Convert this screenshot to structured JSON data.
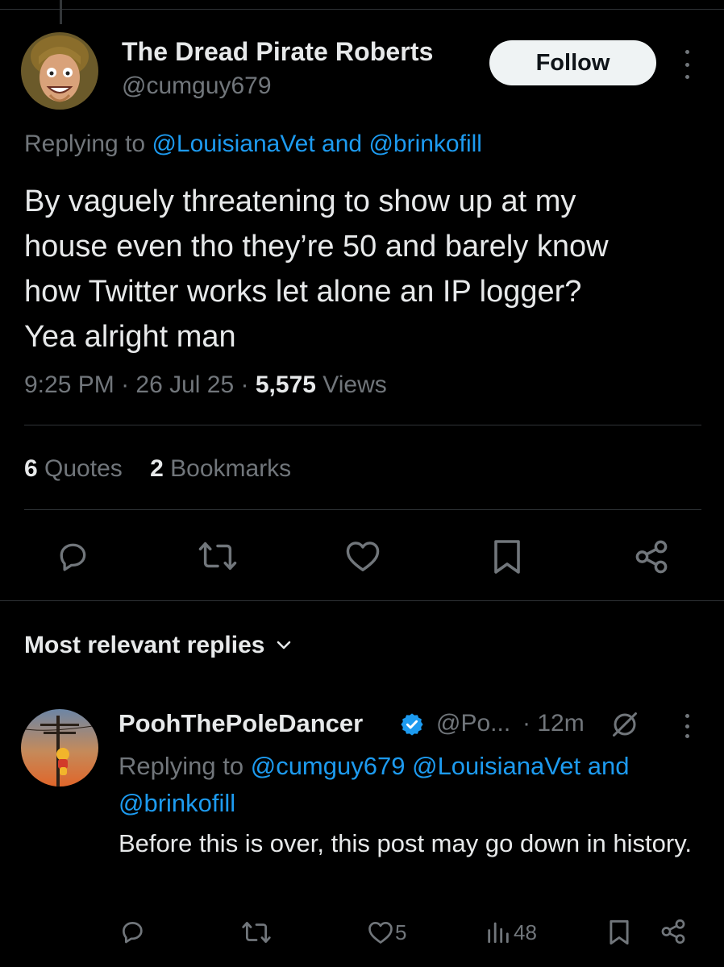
{
  "tweet": {
    "author_name": "The Dread Pirate Roberts",
    "author_handle": "@cumguy679",
    "follow_label": "Follow",
    "replying_prefix": "Replying to",
    "replying_user1": "@LouisianaVet",
    "replying_and": "and",
    "replying_user2": "@brinkofill",
    "text_lines": [
      "By vaguely threatening to show up at my",
      "house even tho they’re 50 and barely know",
      "how Twitter works let alone an IP logger?",
      "Yea alright man"
    ],
    "time": "9:25 PM",
    "separator": "·",
    "date": "26 Jul 25",
    "views_count": "5,575",
    "views_label": "Views",
    "quotes_count": "6",
    "quotes_label": "Quotes",
    "bookmarks_count": "2",
    "bookmarks_label": "Bookmarks"
  },
  "replies_header": {
    "label": "Most relevant replies"
  },
  "reply": {
    "author_name": "PoohThePoleDancer",
    "author_handle": "@Po...",
    "time": "· 12m",
    "replying_prefix": "Replying to",
    "replying_user1": "@cumguy679",
    "replying_user2": "@LouisianaVet",
    "replying_and": "and",
    "replying_user3": "@brinkofill",
    "text": "Before this is over, this post may go down in history.",
    "likes_count": "5",
    "views_count": "48"
  },
  "colors": {
    "background": "#000000",
    "text_primary": "#e7e9ea",
    "text_secondary": "#71767b",
    "link": "#1d9bf0",
    "divider": "#2f3336",
    "follow_bg": "#eff3f4"
  },
  "icons": {
    "reply": "reply-bubble-icon",
    "retweet": "retweet-icon",
    "like": "heart-icon",
    "bookmark": "bookmark-icon",
    "share": "share-icon",
    "views": "bar-chart-icon",
    "verified": "verified-badge-icon",
    "grok": "grok-icon",
    "more": "more-dots-icon",
    "chevron": "chevron-down-icon"
  }
}
